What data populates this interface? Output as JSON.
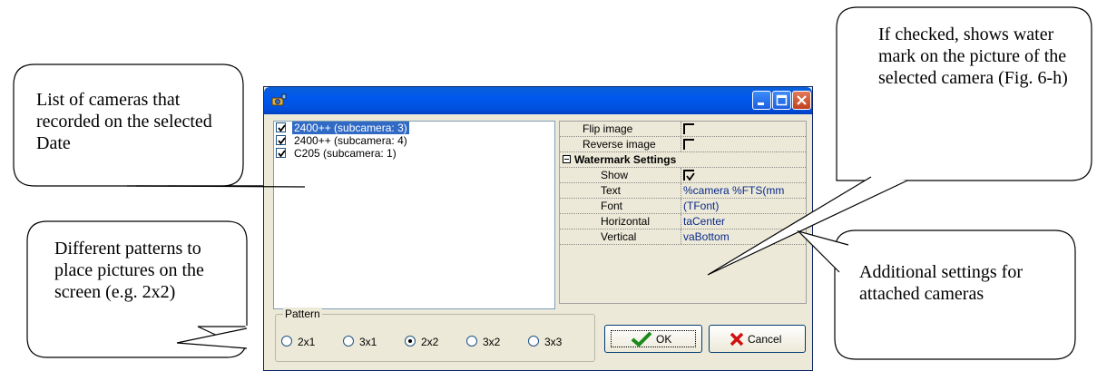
{
  "callouts": {
    "cameras": "List of cameras that recorded on the selected Date",
    "patterns": "Different patterns to place pictures on the screen  (e.g. 2x2)",
    "watermark": "If checked, shows water mark on the picture of the selected camera (Fig. 6-h)",
    "additional": "Additional settings for attached cameras"
  },
  "window": {
    "icon": "camera-app-icon",
    "buttons": [
      "minimize-icon",
      "maximize-icon",
      "close-icon"
    ]
  },
  "camera_list": [
    {
      "label": "2400++ (subcamera: 3)",
      "checked": true,
      "selected": true
    },
    {
      "label": "2400++ (subcamera: 4)",
      "checked": true,
      "selected": false
    },
    {
      "label": "C205 (subcamera: 1)",
      "checked": true,
      "selected": false
    }
  ],
  "properties": {
    "flip_image": "Flip image",
    "reverse_image": "Reverse image",
    "watermark_category": "Watermark Settings",
    "show": "Show",
    "text": {
      "name": "Text",
      "value": "%camera %FTS(mm"
    },
    "font": {
      "name": "Font",
      "value": "(TFont)"
    },
    "horizontal": {
      "name": "Horizontal",
      "value": "taCenter"
    },
    "vertical": {
      "name": "Vertical",
      "value": "vaBottom"
    }
  },
  "pattern": {
    "label": "Pattern",
    "options": [
      "2x1",
      "3x1",
      "2x2",
      "3x2",
      "3x3"
    ],
    "selected": "2x2"
  },
  "buttons": {
    "ok": "OK",
    "cancel": "Cancel"
  }
}
